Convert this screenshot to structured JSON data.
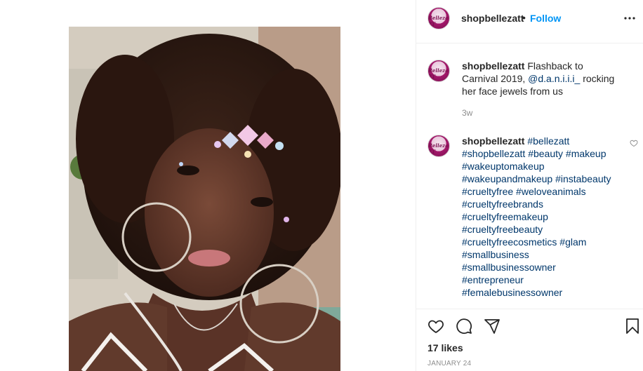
{
  "post": {
    "username": "shopbellezatt",
    "separator": "•",
    "follow_label": "Follow",
    "avatar_logo_text": "Belleza TT"
  },
  "caption": {
    "username": "shopbellezatt",
    "text_before": " Flashback to Carnival 2019, ",
    "mention": "@d.a.n.i.i.i_",
    "text_after": " rocking her face jewels from us",
    "time": "3w"
  },
  "hashtag_comment": {
    "username": "shopbellezatt",
    "tags": [
      "#bellezatt",
      "#shopbellezatt",
      "#beauty",
      "#makeup",
      "#wakeuptomakeup",
      "#wakeupandmakeup",
      "#instabeauty",
      "#crueltyfree",
      "#weloveanimals",
      "#crueltyfreebrands",
      "#crueltyfreemakeup",
      "#crueltyfreebeauty",
      "#crueltyfreecosmetics",
      "#glam",
      "#smallbusiness",
      "#smallbusinessowner",
      "#entrepreneur",
      "#femalebusinessowner"
    ]
  },
  "actions": {
    "icons": [
      "heart-icon",
      "comment-icon",
      "share-icon",
      "bookmark-icon"
    ],
    "likes": "17 likes",
    "date": "JANUARY 24"
  },
  "colors": {
    "link_blue": "#0095f6",
    "hashtag": "#00376b",
    "muted": "#8e8e8e",
    "text": "#262626",
    "border": "#efefef"
  }
}
